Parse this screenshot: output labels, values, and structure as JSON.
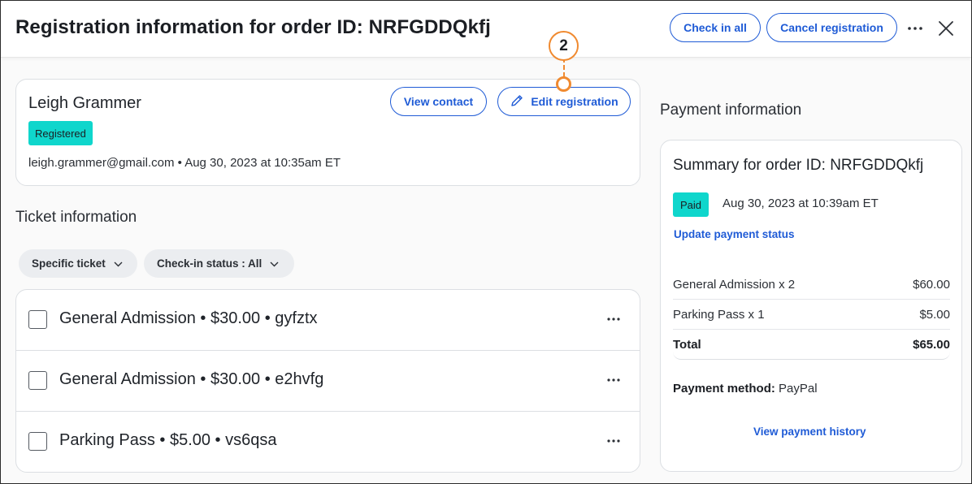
{
  "header": {
    "title": "Registration information for order ID: NRFGDDQkfj",
    "check_in_all_label": "Check in all",
    "cancel_registration_label": "Cancel registration",
    "more_icon": "more-horizontal-icon",
    "close_icon": "close-icon"
  },
  "contact": {
    "name": "Leigh Grammer",
    "view_contact_label": "View contact",
    "edit_registration_label": "Edit registration",
    "edit_icon": "pencil-icon",
    "status_badge": "Registered",
    "meta": "leigh.grammer@gmail.com • Aug 30, 2023 at 10:35am ET"
  },
  "callout": {
    "number": "2"
  },
  "tickets": {
    "section_title": "Ticket information",
    "filters": [
      {
        "label": "Specific ticket"
      },
      {
        "label": "Check-in status : All"
      }
    ],
    "rows": [
      {
        "label": "General Admission • $30.00 • gyfztx"
      },
      {
        "label": "General Admission • $30.00 • e2hvfg"
      },
      {
        "label": "Parking Pass • $5.00 • vs6qsa"
      }
    ]
  },
  "payment": {
    "section_title": "Payment information",
    "summary_title": "Summary for order ID: NRFGDDQkfj",
    "status_badge": "Paid",
    "paid_date": "Aug 30, 2023 at 10:39am ET",
    "update_link": "Update payment status",
    "lines": [
      {
        "item": "General Admission x 2",
        "amount": "$60.00"
      },
      {
        "item": "Parking Pass x 1",
        "amount": "$5.00"
      },
      {
        "item": "Total",
        "amount": "$65.00"
      }
    ],
    "method_label": "Payment method:",
    "method_value": "PayPal",
    "history_link": "View payment history"
  },
  "colors": {
    "accent": "#1f5bd6",
    "badge": "#0fd6cc",
    "callout": "#f08a30"
  }
}
